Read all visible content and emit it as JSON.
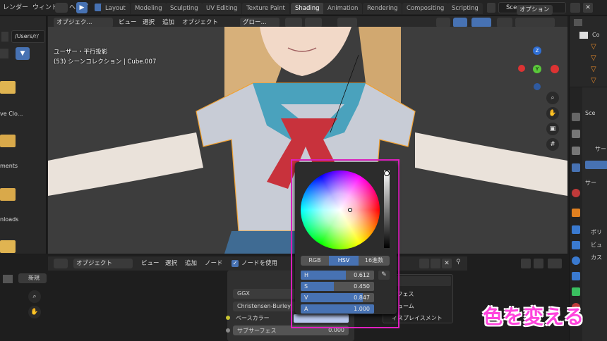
{
  "topbar": {
    "menus": [
      "レンダー",
      "ウィンドウ",
      "ヘルプ"
    ],
    "workspaces": [
      "Layout",
      "Modeling",
      "Sculpting",
      "UV Editing",
      "Texture Paint",
      "Shading",
      "Animation",
      "Rendering",
      "Compositing",
      "Scripting"
    ],
    "active_workspace": "Shading",
    "scene_name": "Scene"
  },
  "filebrowser": {
    "path": "/Users/r/",
    "items": [
      "ve Clo...",
      "ments",
      "nloads"
    ]
  },
  "viewport_header": {
    "mode": "オブジェク...",
    "menus": [
      "ビュー",
      "選択",
      "追加",
      "オブジェクト"
    ],
    "orientation": "グロー...",
    "options": "オプション"
  },
  "viewport_overlay": {
    "view_name": "ユーザー・平行投影",
    "collection_info": "(53) シーンコレクション | Cube.007"
  },
  "gizmo": {
    "z": "Z",
    "y": "Y"
  },
  "node_header": {
    "mode": "オブジェクト",
    "menus": [
      "ビュー",
      "選択",
      "追加",
      "ノード"
    ],
    "use_nodes_label": "ノードを使用",
    "new_label": "新規"
  },
  "nodes": {
    "distribution": "GGX",
    "subsurface_method": "Christensen-Burley",
    "base_color_label": "ベースカラー",
    "subsurface_label": "サブサーフェス",
    "subsurface_value": "0.000"
  },
  "color_picker": {
    "tabs": [
      "RGB",
      "HSV",
      "16進数"
    ],
    "active_tab": "HSV",
    "sliders": [
      {
        "label": "H",
        "value": "0.612",
        "fraction": 0.612
      },
      {
        "label": "S",
        "value": "0.450",
        "fraction": 0.45
      },
      {
        "label": "V",
        "value": "0.847",
        "fraction": 0.847
      },
      {
        "label": "A",
        "value": "1.000",
        "fraction": 1.0
      }
    ]
  },
  "dropdown": {
    "items": [
      "ーフェス",
      "リューム",
      "ィスプレイスメント"
    ]
  },
  "outliner": {
    "label": "Co"
  },
  "properties": {
    "items": [
      "Sce",
      "サー",
      "サー",
      "ボリ",
      "ビュ",
      "カス"
    ]
  },
  "caption": "色を変える",
  "colors": {
    "accent": "#4772b3",
    "highlight_border": "#e020c0",
    "caption": "#ff44dd",
    "selection_outline": "#f0a030"
  }
}
